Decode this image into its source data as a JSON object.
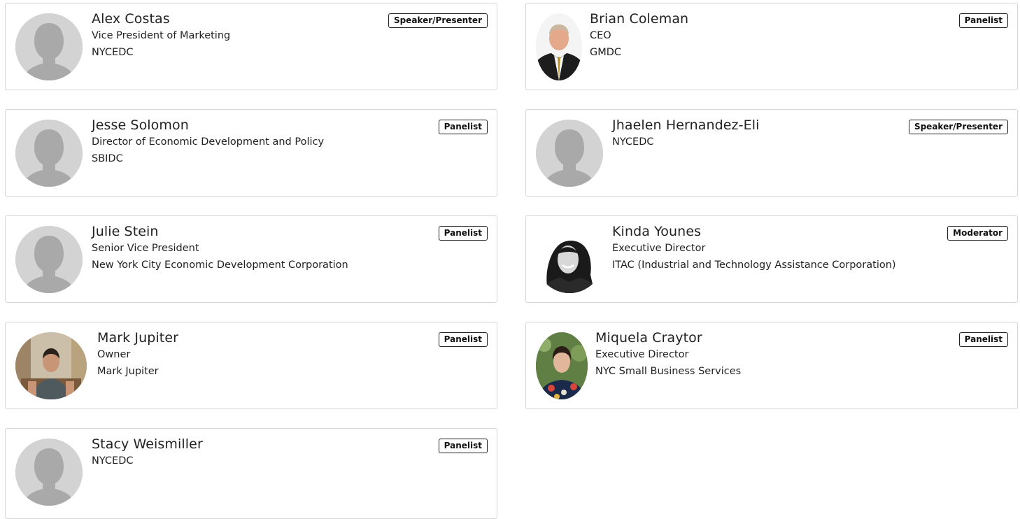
{
  "people": [
    {
      "name": "Alex Costas",
      "lines": [
        "Vice President of Marketing",
        "NYCEDC"
      ],
      "role": "Speaker/Presenter",
      "avatar": "default-avatar-icon"
    },
    {
      "name": "Brian Coleman",
      "lines": [
        "CEO",
        "GMDC"
      ],
      "role": "Panelist",
      "avatar": "photo"
    },
    {
      "name": "Jesse Solomon",
      "lines": [
        "Director of Economic Development and Policy",
        "SBIDC"
      ],
      "role": "Panelist",
      "avatar": "default-avatar-icon"
    },
    {
      "name": "Jhaelen Hernandez-Eli",
      "lines": [
        "NYCEDC"
      ],
      "role": "Speaker/Presenter",
      "avatar": "default-avatar-icon"
    },
    {
      "name": "Julie Stein",
      "lines": [
        "Senior Vice President",
        "New York City Economic Development Corporation"
      ],
      "role": "Panelist",
      "avatar": "default-avatar-icon"
    },
    {
      "name": "Kinda Younes",
      "lines": [
        "Executive Director",
        "ITAC (Industrial and Technology Assistance Corporation)"
      ],
      "role": "Moderator",
      "avatar": "photo"
    },
    {
      "name": "Mark Jupiter",
      "lines": [
        "Owner",
        "Mark Jupiter"
      ],
      "role": "Panelist",
      "avatar": "photo"
    },
    {
      "name": "Miquela Craytor",
      "lines": [
        "Executive Director",
        "NYC Small Business Services"
      ],
      "role": "Panelist",
      "avatar": "photo"
    },
    {
      "name": "Stacy Weismiller",
      "lines": [
        "NYCEDC"
      ],
      "role": "Panelist",
      "avatar": "default-avatar-icon"
    }
  ]
}
